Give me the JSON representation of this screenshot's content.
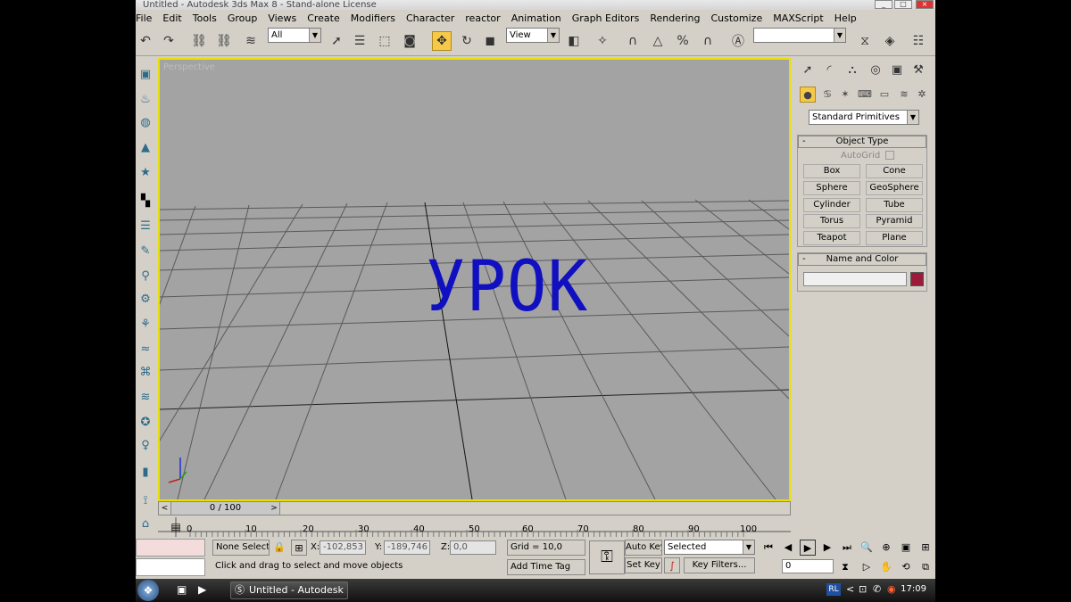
{
  "window": {
    "title": "Untitled - Autodesk 3ds Max 8 - Stand-alone License",
    "minimize": "_",
    "maximize": "□",
    "close": "×"
  },
  "menu": [
    "File",
    "Edit",
    "Tools",
    "Group",
    "Views",
    "Create",
    "Modifiers",
    "Character",
    "reactor",
    "Animation",
    "Graph Editors",
    "Rendering",
    "Customize",
    "MAXScript",
    "Help"
  ],
  "toolbar": {
    "selection_filter": "All",
    "ref_coord": "View",
    "named_selection": ""
  },
  "viewport": {
    "label": "Perspective",
    "overlay_text": "УРОК"
  },
  "command_panel": {
    "category": "Standard Primitives",
    "object_type": {
      "title": "Object Type",
      "autogrid": "AutoGrid",
      "buttons": [
        "Box",
        "Cone",
        "Sphere",
        "GeoSphere",
        "Cylinder",
        "Tube",
        "Torus",
        "Pyramid",
        "Teapot",
        "Plane"
      ]
    },
    "name_color": {
      "title": "Name and Color",
      "name_value": "",
      "color": "#9b1c3a"
    }
  },
  "time": {
    "slider": "0 / 100",
    "ticks": [
      "0",
      "10",
      "20",
      "30",
      "40",
      "50",
      "60",
      "70",
      "80",
      "90",
      "100"
    ]
  },
  "status": {
    "selection": "None Selecte",
    "x_label": "X:",
    "x": "-102,853",
    "y_label": "Y:",
    "y": "-189,746",
    "z_label": "Z:",
    "z": "0,0",
    "grid": "Grid = 10,0",
    "prompt": "Click and drag to select and move objects",
    "add_time_tag": "Add Time Tag",
    "auto_key": "Auto Key",
    "set_key": "Set Key",
    "key_mode": "Selected",
    "key_filters": "Key Filters...",
    "frame": "0"
  },
  "taskbar": {
    "task": "Untitled - Autodesk ...",
    "lang": "RL",
    "clock": "17:09"
  }
}
